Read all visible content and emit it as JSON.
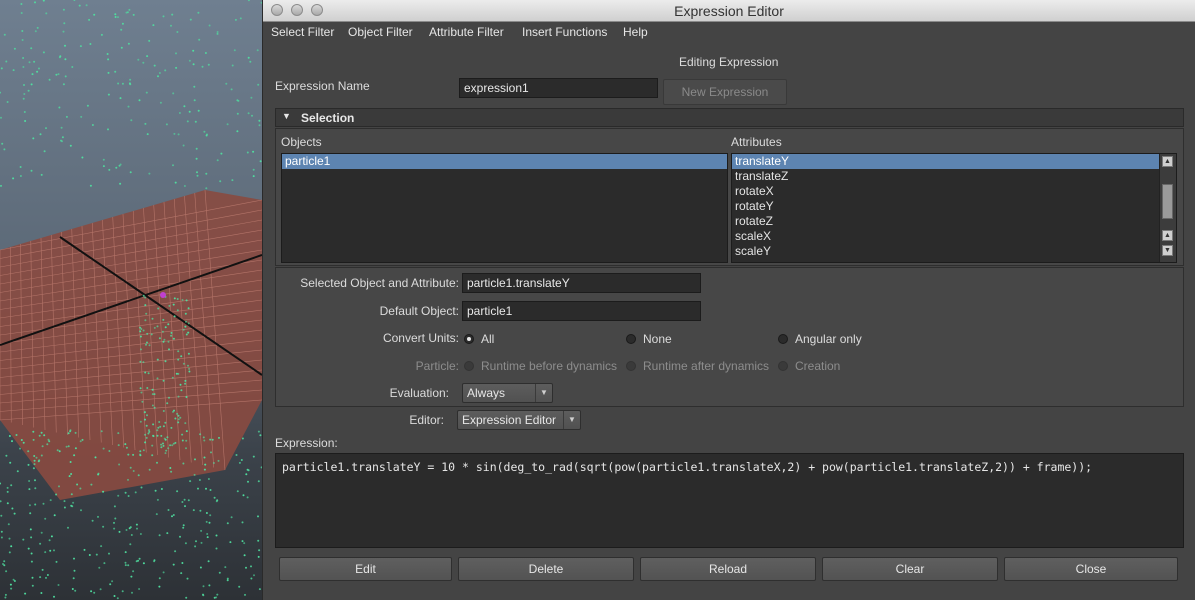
{
  "window": {
    "title": "Expression Editor"
  },
  "menu": [
    "Select Filter",
    "Object Filter",
    "Attribute Filter",
    "Insert Functions",
    "Help"
  ],
  "editing_label": "Editing Expression",
  "expression_name": {
    "label": "Expression Name",
    "value": "expression1",
    "new_button": "New Expression"
  },
  "selection": {
    "header": "Selection",
    "objects_label": "Objects",
    "attributes_label": "Attributes",
    "objects": [
      "particle1"
    ],
    "selected_object": "particle1",
    "attributes": [
      "translateY",
      "translateZ",
      "rotateX",
      "rotateY",
      "rotateZ",
      "scaleX",
      "scaleY"
    ],
    "selected_attribute": "translateY"
  },
  "selected_obj_attr": {
    "label": "Selected Object and Attribute:",
    "value": "particle1.translateY"
  },
  "default_object": {
    "label": "Default Object:",
    "value": "particle1"
  },
  "convert_units": {
    "label": "Convert Units:",
    "options": [
      "All",
      "None",
      "Angular only"
    ],
    "selected": "All"
  },
  "particle": {
    "label": "Particle:",
    "options": [
      "Runtime before dynamics",
      "Runtime after dynamics",
      "Creation"
    ]
  },
  "evaluation": {
    "label": "Evaluation:",
    "value": "Always"
  },
  "editor": {
    "label": "Editor:",
    "value": "Expression Editor"
  },
  "expression": {
    "label": "Expression:",
    "text": "particle1.translateY = 10 * sin(deg_to_rad(sqrt(pow(particle1.translateX,2) + pow(particle1.translateZ,2)) + frame));"
  },
  "buttons": {
    "edit": "Edit",
    "delete": "Delete",
    "reload": "Reload",
    "clear": "Clear",
    "close": "Close"
  },
  "icons": {
    "collapse": "triangle-down-icon",
    "dropdown": "chevron-down-icon",
    "scroll_up": "arrow-up-icon",
    "scroll_down": "arrow-down-icon"
  },
  "colors": {
    "selection_highlight": "#5d84b1",
    "particles": "#4fe0a0",
    "ground_grid": "#b5584a"
  }
}
